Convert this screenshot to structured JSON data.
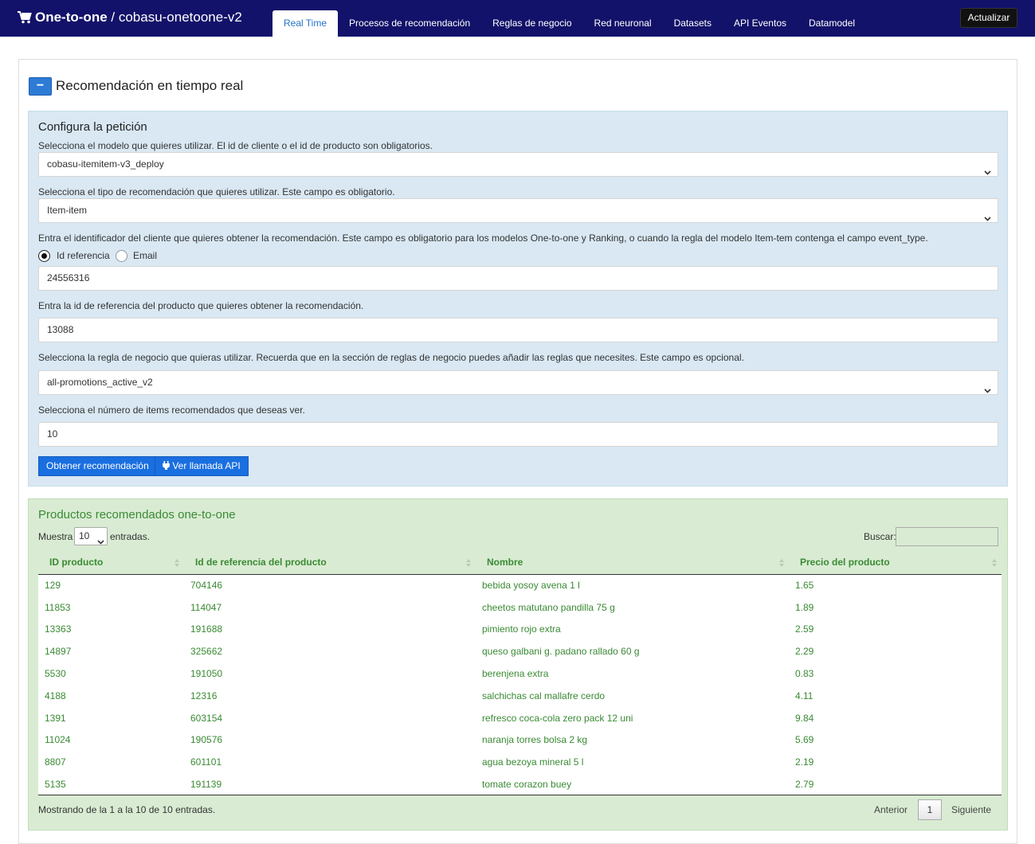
{
  "header": {
    "brand_bold": "One-to-one",
    "brand_rest": " / cobasu-onetoone-v2",
    "tabs": [
      "Real Time",
      "Procesos de recomendación",
      "Reglas de negocio",
      "Red neuronal",
      "Datasets",
      "API Eventos",
      "Datamodel"
    ],
    "active_tab": "Real Time",
    "update_label": "Actualizar"
  },
  "section": {
    "collapse_symbol": "−",
    "title": "Recomendación en tiempo real"
  },
  "config": {
    "title": "Configura la petición",
    "model_label": "Selecciona el modelo que quieres utilizar. El id de cliente o el id de producto son obligatorios.",
    "model_value": "cobasu-itemitem-v3_deploy",
    "type_label": "Selecciona el tipo de recomendación que quieres utilizar. Este campo es obligatorio.",
    "type_value": "Item-item",
    "client_label": "Entra el identificador del cliente que quieres obtener la recomendación. Este campo es obligatorio para los modelos One-to-one y Ranking, o cuando la regla del modelo Item-tem contenga el campo event_type.",
    "radio_id": "Id referencia",
    "radio_email": "Email",
    "radio_selected": "Id referencia",
    "client_value": "24556316",
    "product_label": "Entra la id de referencia del producto que quieres obtener la recomendación.",
    "product_value": "13088",
    "rule_label": "Selecciona la regla de negocio que quieras utilizar. Recuerda que en la sección de reglas de negocio puedes añadir las reglas que necesites. Este campo es opcional.",
    "rule_value": "all-promotions_active_v2",
    "count_label": "Selecciona el número de items recomendados que deseas ver.",
    "count_value": "10",
    "get_btn": "Obtener recomendación",
    "api_btn": "Ver llamada API"
  },
  "results": {
    "title": "Productos recomendados one-to-one",
    "show_prefix": "Muestra",
    "show_value": "10",
    "show_suffix": "entradas.",
    "search_label": "Buscar:",
    "columns": [
      "ID producto",
      "Id de referencia del producto",
      "Nombre",
      "Precio del producto"
    ],
    "rows": [
      [
        "129",
        "704146",
        "bebida yosoy avena 1 l",
        "1.65"
      ],
      [
        "11853",
        "114047",
        "cheetos matutano pandilla 75 g",
        "1.89"
      ],
      [
        "13363",
        "191688",
        "pimiento rojo extra",
        "2.59"
      ],
      [
        "14897",
        "325662",
        "queso galbani g. padano rallado 60 g",
        "2.29"
      ],
      [
        "5530",
        "191050",
        "berenjena extra",
        "0.83"
      ],
      [
        "4188",
        "12316",
        "salchichas cal mallafre cerdo",
        "4.11"
      ],
      [
        "1391",
        "603154",
        "refresco coca-cola zero pack 12 uni",
        "9.84"
      ],
      [
        "11024",
        "190576",
        "naranja torres bolsa 2 kg",
        "5.69"
      ],
      [
        "8807",
        "601101",
        "agua bezoya mineral 5 l",
        "2.19"
      ],
      [
        "5135",
        "191139",
        "tomate corazon buey",
        "2.79"
      ]
    ],
    "info": "Mostrando de la 1 a la 10 de 10 entradas.",
    "prev_label": "Anterior",
    "current_page": "1",
    "next_label": "Siguiente"
  },
  "colors": {
    "topbar": "#12126a",
    "accent_blue": "#1a6fe0",
    "config_bg": "#d9e8f3",
    "results_bg": "#d9ecd3",
    "results_text": "#3a8a34"
  },
  "icons": {
    "brand": "cart-icon",
    "api_button": "plug-icon",
    "select": "chevron-down-icon",
    "table_header": "sort-icon"
  }
}
